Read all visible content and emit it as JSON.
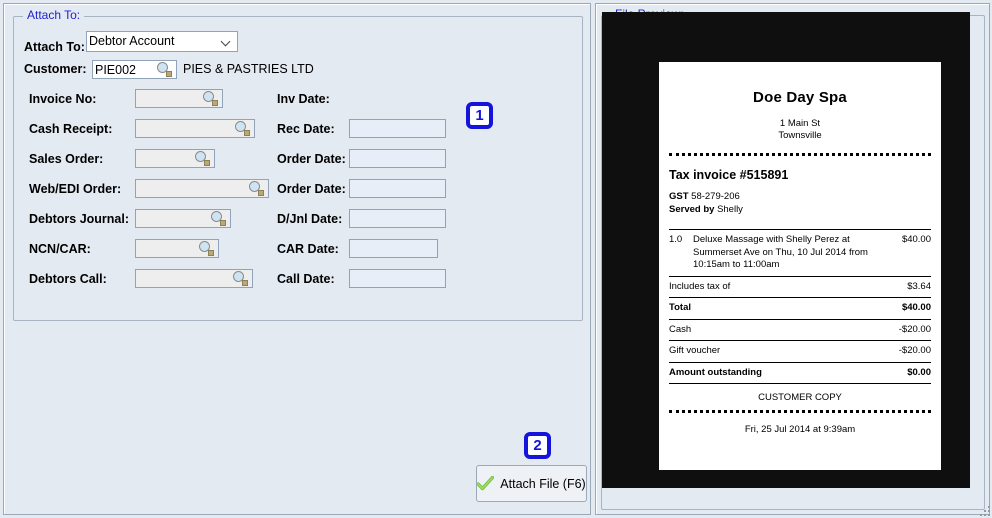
{
  "left_panel": {
    "group_title": "Attach To:",
    "attach_to": {
      "label": "Attach To:",
      "value": "Debtor Account",
      "options": [
        "Debtor Account"
      ]
    },
    "customer": {
      "label": "Customer:",
      "code": "PIE002",
      "name": "PIES & PASTRIES LTD",
      "lookup_icon": "magnifier-icon"
    },
    "rows": [
      {
        "label": "Invoice No:",
        "value": "",
        "date_label": "Inv Date:",
        "date_value": "",
        "has_date_input": false,
        "field_width": 88,
        "lookup_icon": "magnifier-icon"
      },
      {
        "label": "Cash Receipt:",
        "value": "",
        "date_label": "Rec Date:",
        "date_value": "",
        "has_date_input": true,
        "field_width": 120,
        "lookup_icon": "magnifier-icon"
      },
      {
        "label": "Sales Order:",
        "value": "",
        "date_label": "Order Date:",
        "date_value": "",
        "has_date_input": true,
        "field_width": 80,
        "lookup_icon": "magnifier-icon"
      },
      {
        "label": "Web/EDI Order:",
        "value": "",
        "date_label": "Order Date:",
        "date_value": "",
        "has_date_input": true,
        "field_width": 134,
        "lookup_icon": "magnifier-icon"
      },
      {
        "label": "Debtors Journal:",
        "value": "",
        "date_label": "D/Jnl Date:",
        "date_value": "",
        "has_date_input": true,
        "field_width": 96,
        "lookup_icon": "magnifier-icon"
      },
      {
        "label": "NCN/CAR:",
        "value": "",
        "date_label": "CAR Date:",
        "date_value": "",
        "has_date_input": true,
        "field_width": 84,
        "lookup_icon": "magnifier-icon"
      },
      {
        "label": "Debtors Call:",
        "value": "",
        "date_label": "Call Date:",
        "date_value": "",
        "has_date_input": true,
        "field_width": 118,
        "lookup_icon": "magnifier-icon"
      }
    ],
    "badge_one": "1",
    "badge_two": "2",
    "attach_button": {
      "label": "Attach File (F6)",
      "icon": "green-check-icon"
    }
  },
  "right_panel": {
    "group_title": "File Preview:"
  },
  "receipt": {
    "business_name": "Doe Day Spa",
    "address_line1": "1 Main St",
    "address_line2": "Townsville",
    "invoice_heading": "Tax invoice #515891",
    "gst_label": "GST",
    "gst_number": "58-279-206",
    "served_label": "Served by",
    "served_by": "Shelly",
    "line_items": [
      {
        "qty": "1.0",
        "description": "Deluxe Massage with Shelly Perez at Summerset Ave on Thu, 10 Jul 2014 from 10:15am to 11:00am",
        "amount": "$40.00"
      }
    ],
    "summary": [
      {
        "label": "Includes tax of",
        "amount": "$3.64",
        "bold": false
      },
      {
        "label": "Total",
        "amount": "$40.00",
        "bold": true
      },
      {
        "label": "Cash",
        "amount": "-$20.00",
        "bold": false
      },
      {
        "label": "Gift voucher",
        "amount": "-$20.00",
        "bold": false
      },
      {
        "label": "Amount outstanding",
        "amount": "$0.00",
        "bold": true
      }
    ],
    "copy_notice": "CUSTOMER COPY",
    "footer_date": "Fri, 25 Jul 2014 at 9:39am"
  },
  "colors": {
    "panel_background": "#e4eaf2",
    "group_title": "#2222cc",
    "badge": "#1414dd",
    "preview_background": "#0f0f0f",
    "input_border": "#8fa3bb",
    "check_icon": "#7ac53f"
  }
}
